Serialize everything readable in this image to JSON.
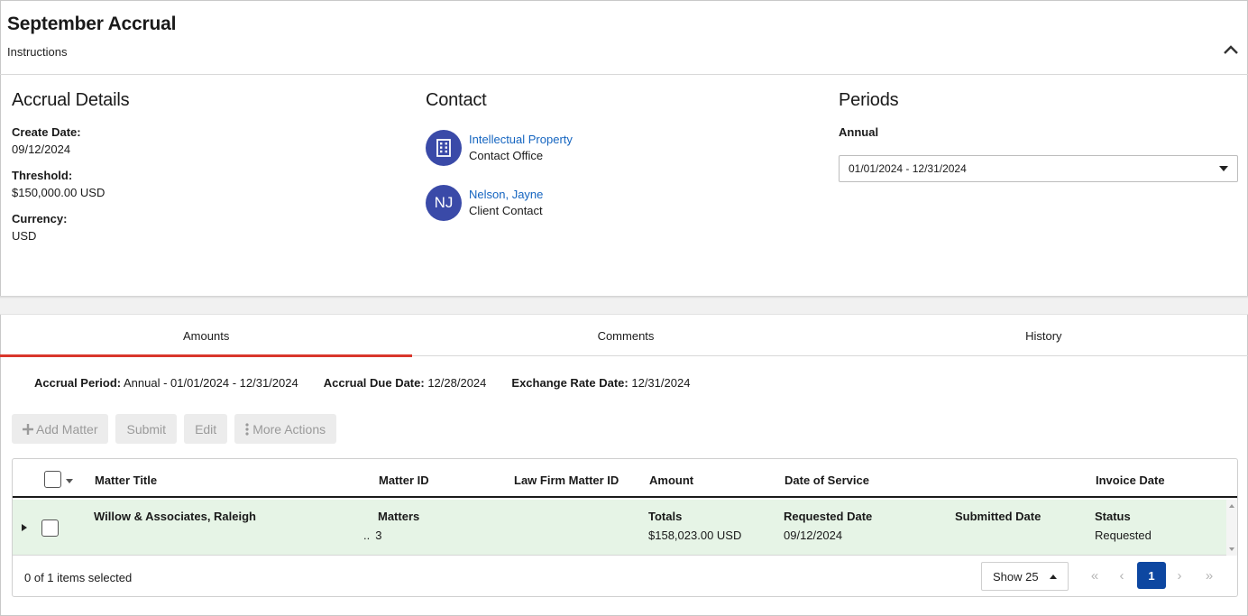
{
  "header": {
    "title": "September Accrual",
    "subtitle": "Instructions"
  },
  "details": {
    "heading": "Accrual Details",
    "fields": [
      {
        "label": "Create Date:",
        "value": "09/12/2024"
      },
      {
        "label": "Threshold:",
        "value": "$150,000.00 USD"
      },
      {
        "label": "Currency:",
        "value": "USD"
      }
    ]
  },
  "contact": {
    "heading": "Contact",
    "items": [
      {
        "avatar_icon": "building-icon",
        "name": "Intellectual Property",
        "role": "Contact Office"
      },
      {
        "initials": "NJ",
        "name": "Nelson, Jayne",
        "role": "Client Contact"
      }
    ]
  },
  "periods": {
    "heading": "Periods",
    "label": "Annual",
    "selected": "01/01/2024 - 12/31/2024"
  },
  "tabs": [
    {
      "label": "Amounts",
      "active": true
    },
    {
      "label": "Comments"
    },
    {
      "label": "History"
    }
  ],
  "info": {
    "accrual_period_label": "Accrual Period:",
    "accrual_period_value": "Annual - 01/01/2024 - 12/31/2024",
    "due_label": "Accrual Due Date:",
    "due_value": "12/28/2024",
    "rate_label": "Exchange Rate Date:",
    "rate_value": "12/31/2024"
  },
  "actions": {
    "add": "Add Matter",
    "submit": "Submit",
    "edit": "Edit",
    "more": "More Actions"
  },
  "table": {
    "columns": [
      "Matter Title",
      "Matter ID",
      "Law Firm Matter ID",
      "Amount",
      "Date of Service",
      "Invoice Date"
    ],
    "row": {
      "title": "Willow & Associates, Raleigh",
      "matters_label": "Matters",
      "matters_prefix": "..",
      "matters_value": "3",
      "totals_label": "Totals",
      "totals_value": "$158,023.00 USD",
      "requested_label": "Requested Date",
      "requested_value": "09/12/2024",
      "submitted_label": "Submitted Date",
      "status_label": "Status",
      "status_value": "Requested"
    }
  },
  "footer": {
    "selected": "0 of 1 items selected",
    "show": "Show 25",
    "page": "1",
    "first": "«",
    "prev": "‹",
    "next": "›",
    "last": "»"
  },
  "colors": {
    "accent": "#d9362b",
    "link": "#1565c0",
    "avatar": "#3a4aa8",
    "row_bg": "#e6f4e6",
    "page_active": "#0d47a1"
  }
}
